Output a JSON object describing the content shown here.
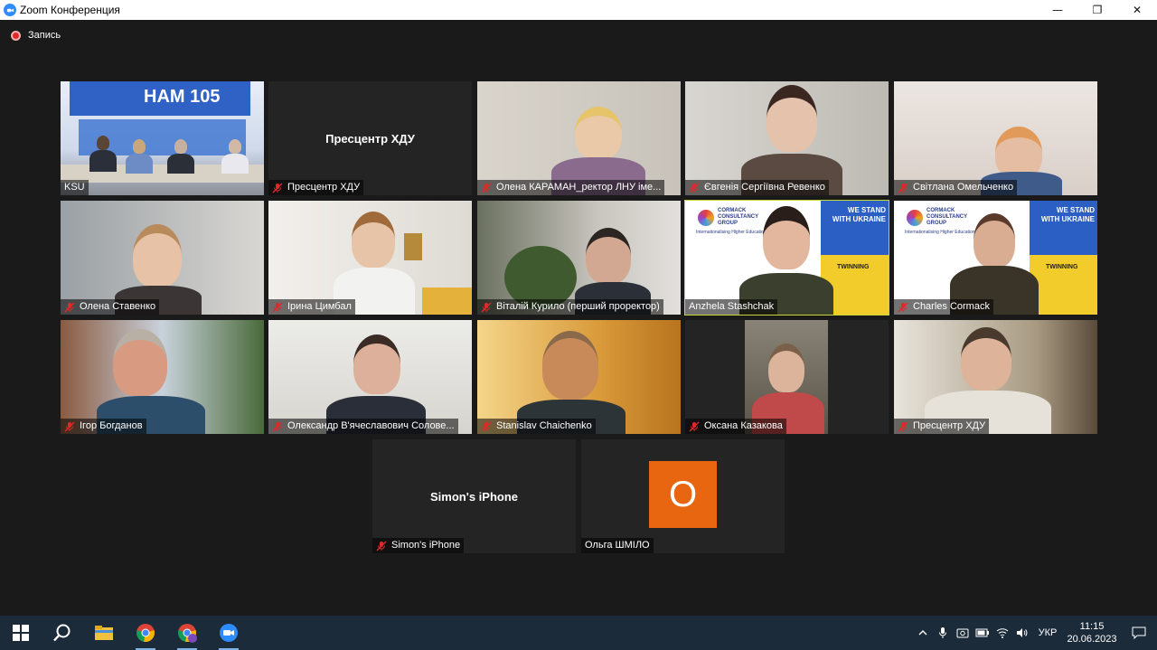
{
  "window": {
    "title": "Zoom Конференция",
    "minimize_glyph": "—",
    "maximize_glyph": "❐",
    "close_glyph": "✕"
  },
  "recording": {
    "label": "Запись"
  },
  "tiles": [
    {
      "name": "KSU",
      "muted": false,
      "center": "",
      "banner": "НАМ 105"
    },
    {
      "name": "Пресцентр ХДУ",
      "muted": true,
      "center": "Пресцентр ХДУ"
    },
    {
      "name": "Олена КАРАМАН_ректор ЛНУ іме...",
      "muted": true,
      "center": ""
    },
    {
      "name": "Євгенія Сергіївна Ревенко",
      "muted": true,
      "center": ""
    },
    {
      "name": "Світлана Омельченко",
      "muted": true,
      "center": ""
    },
    {
      "name": "Олена Ставенко",
      "muted": true,
      "center": ""
    },
    {
      "name": "Ірина Цимбал",
      "muted": true,
      "center": ""
    },
    {
      "name": "Віталій Курило (перший проректор)",
      "muted": true,
      "center": ""
    },
    {
      "name": "Anzhela Stashchak",
      "muted": false,
      "center": "",
      "active": true,
      "banner_left": "CORMACK CONSULTANCY GROUP",
      "banner_right": "WE STAND WITH UKRAINE",
      "banner_sub": "Internationalising Higher Education",
      "banner_logo": "TWINNING"
    },
    {
      "name": "Charles Cormack",
      "muted": true,
      "center": "",
      "banner_left": "CORMACK CONSULTANCY GROUP",
      "banner_right": "WE STAND WITH UKRAINE",
      "banner_sub": "Internationalising Higher Education",
      "banner_logo": "TWINNING"
    },
    {
      "name": "Ігор Богданов",
      "muted": true,
      "center": ""
    },
    {
      "name": "Олександр В'ячеславович Солове...",
      "muted": true,
      "center": ""
    },
    {
      "name": "Stanislav Chaichenko",
      "muted": true,
      "center": ""
    },
    {
      "name": "Оксана Казакова",
      "muted": true,
      "center": ""
    },
    {
      "name": "Пресцентр ХДУ",
      "muted": true,
      "center": ""
    },
    {
      "name": "Simon's iPhone",
      "muted": true,
      "center": "Simon's iPhone"
    },
    {
      "name": "Ольга ШМІЛО",
      "muted": false,
      "center": "",
      "avatar_letter": "О"
    }
  ],
  "taskbar": {
    "apps": [
      "windows-start",
      "search",
      "file-explorer",
      "chrome",
      "chrome-profile",
      "zoom"
    ],
    "language": "УКР",
    "time": "11:15",
    "date": "20.06.2023"
  },
  "colors": {
    "background": "#1a1a1a",
    "tile": "#242424",
    "active_outline": "#c9d63a",
    "muted_mic": "#e02828",
    "avatar": "#e8660f",
    "taskbar": "#1c2b3a"
  }
}
